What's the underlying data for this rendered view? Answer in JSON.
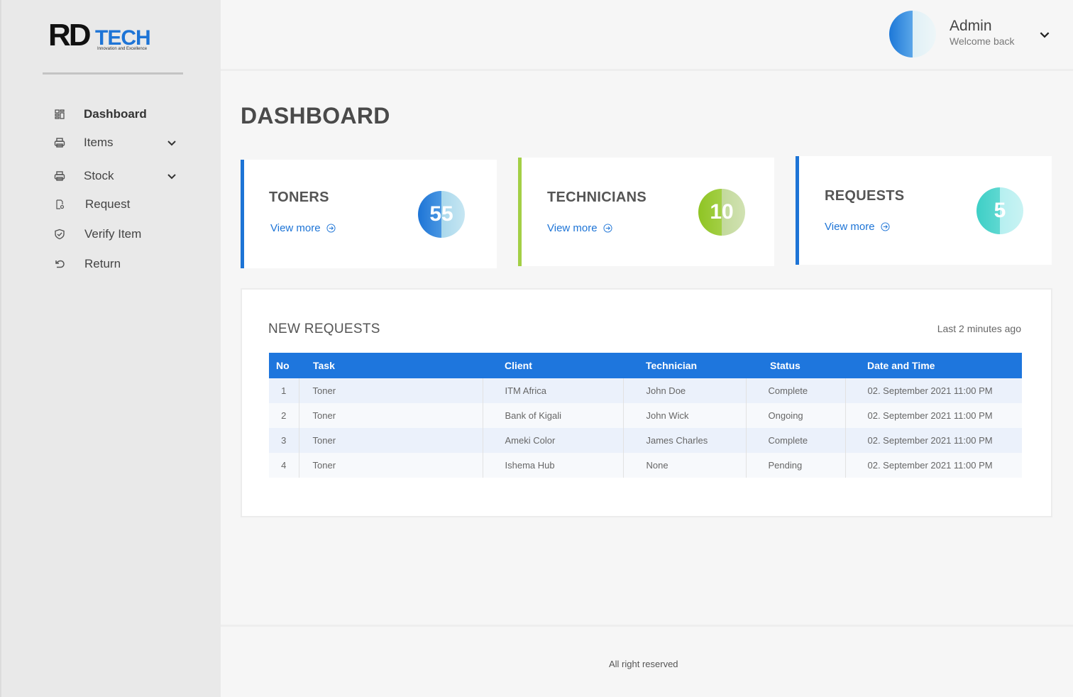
{
  "brand": {
    "logo_rd": "RD",
    "logo_tech": "TECH",
    "tagline": "Innovation and Excellence"
  },
  "sidebar": {
    "items": [
      {
        "label": "Dashboard",
        "icon": "grid-icon",
        "active": true
      },
      {
        "label": "Items",
        "icon": "printer-icon",
        "has_submenu": true
      },
      {
        "label": "Stock",
        "icon": "printer-icon",
        "has_submenu": true
      },
      {
        "label": "Request",
        "icon": "request-icon"
      },
      {
        "label": "Verify Item",
        "icon": "shield-check-icon"
      },
      {
        "label": "Return",
        "icon": "undo-icon"
      }
    ]
  },
  "header": {
    "user_name": "Admin",
    "user_subtitle": "Welcome back"
  },
  "page": {
    "title": "DASHBOARD"
  },
  "cards": [
    {
      "title": "TONERS",
      "link": "View more",
      "count": "55",
      "accent": "#1d74d6"
    },
    {
      "title": "TECHNICIANS",
      "link": "View more",
      "count": "10",
      "accent": "#a3cf45"
    },
    {
      "title": "REQUESTS",
      "link": "View more",
      "count": "5",
      "accent": "#1d74d6"
    }
  ],
  "requests": {
    "title": "NEW REQUESTS",
    "updated": "Last 2 minutes ago",
    "columns": [
      "No",
      "Task",
      "Client",
      "Technician",
      "Status",
      "Date and Time"
    ],
    "rows": [
      [
        "1",
        "Toner",
        "ITM Africa",
        "John Doe",
        "Complete",
        "02. September 2021 11:00 PM"
      ],
      [
        "2",
        "Toner",
        "Bank of Kigali",
        "John Wick",
        "Ongoing",
        "02. September 2021 11:00 PM"
      ],
      [
        "3",
        "Toner",
        "Ameki Color",
        "James Charles",
        "Complete",
        "02. September 2021 11:00 PM"
      ],
      [
        "4",
        "Toner",
        "Ishema Hub",
        "None",
        "Pending",
        "02. September 2021 11:00 PM"
      ]
    ]
  },
  "footer": {
    "text": "All right reserved"
  }
}
